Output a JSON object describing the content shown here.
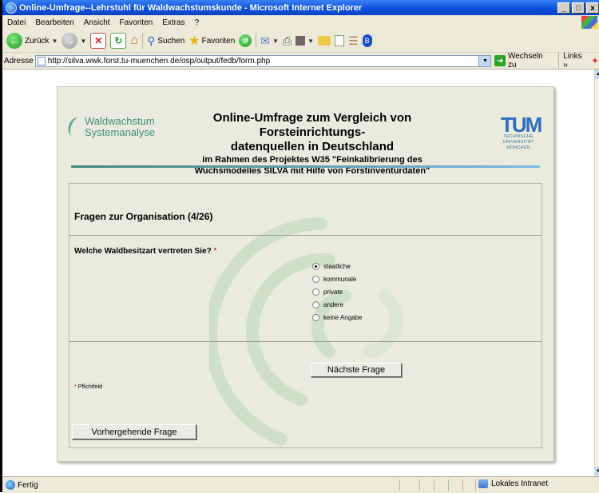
{
  "window": {
    "title": "Online-Umfrage--Lehrstuhl für Waldwachstumskunde - Microsoft Internet Explorer",
    "controls": [
      "_",
      "□",
      "x"
    ]
  },
  "menu": [
    "Datei",
    "Bearbeiten",
    "Ansicht",
    "Favoriten",
    "Extras",
    "?"
  ],
  "toolbar": {
    "back_label": "Zurück",
    "search_label": "Suchen",
    "favorites_label": "Favoriten"
  },
  "address": {
    "label": "Adresse",
    "url": "http://silva.wwk.forst.tu-muenchen.de/osp/output/fedb/form.php",
    "go_label": "Wechseln zu",
    "links_label": "Links"
  },
  "page": {
    "logo_left": {
      "line1": "Waldwachstum",
      "line2": "Systemanalyse"
    },
    "header": {
      "title_line1": "Online-Umfrage zum Vergleich von Forsteinrichtungs-",
      "title_line2": "datenquellen in Deutschland",
      "subtitle_line1": "im Rahmen des Projektes W35 \"Feinkalibrierung des",
      "subtitle_line2": "Wuchsmodelles SILVA mit Hilfe von Forstinventurdaten\""
    },
    "logo_right": {
      "mark": "TUM",
      "line1": "TECHNISCHE",
      "line2": "UNIVERSITÄT",
      "line3": "MÜNCHEN"
    },
    "section_heading": "Fragen zur Organisation (4/26)",
    "question": "Welche Waldbesitzart vertreten Sie?",
    "required_marker": "*",
    "options": [
      {
        "label": "staatliche",
        "selected": true
      },
      {
        "label": "kommunale",
        "selected": false
      },
      {
        "label": "private",
        "selected": false
      },
      {
        "label": "andere",
        "selected": false
      },
      {
        "label": "keine Angabe",
        "selected": false
      }
    ],
    "next_button": "Nächste Frage",
    "required_note": "Pflichtfeld",
    "prev_button": "Vorhergehende Frage"
  },
  "status": {
    "text": "Fertig",
    "zone": "Lokales Intranet"
  },
  "colors": {
    "titlebar": "#0a4fd8",
    "chrome": "#ece9d8",
    "card": "#ebebdd",
    "accent_green": "#3d8c7a",
    "tum_blue": "#2d6ec1",
    "required_red": "#cc0000"
  }
}
